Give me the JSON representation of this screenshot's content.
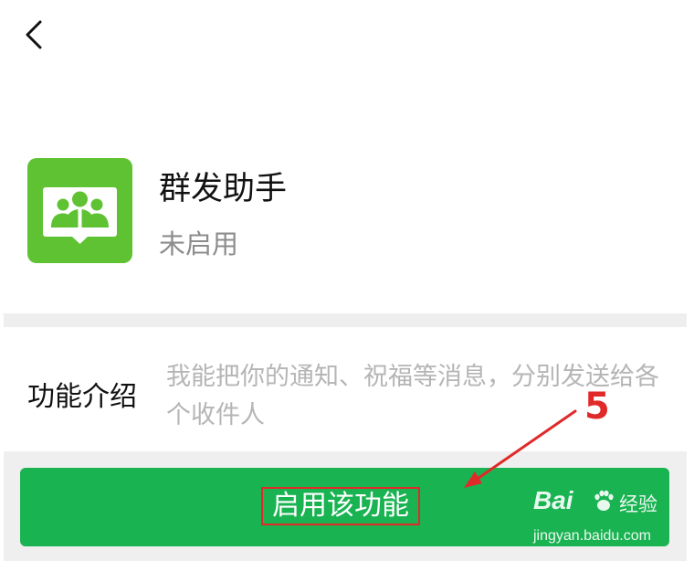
{
  "nav": {
    "back_icon": "chevron-left-icon"
  },
  "app": {
    "icon": "group-message-icon",
    "icon_color": "#5fc233",
    "title": "群发助手",
    "status": "未启用"
  },
  "intro": {
    "label": "功能介绍",
    "text": "我能把你的通知、祝福等消息，分别发送给各个收件人"
  },
  "action": {
    "enable_label": "启用该功能",
    "button_color": "#1ab352"
  },
  "annotation": {
    "step_number": "5",
    "color": "#e02a2a"
  },
  "watermark": {
    "brand_prefix": "Bai",
    "brand_suffix": "经验",
    "domain": "jingyan.baidu.com"
  }
}
